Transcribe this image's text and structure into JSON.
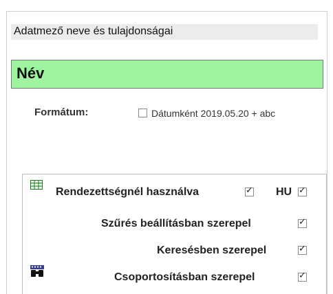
{
  "section_title": "Adatmező neve és tulajdonságai",
  "field_name": "Név",
  "format": {
    "label": "Formátum:",
    "option_label": "Dátumként 2019.05.20 + abc",
    "checked": false
  },
  "options": [
    {
      "icon": "table-grid-icon",
      "label": "Rendezettségnél használva",
      "checked": true
    },
    {
      "label": "HU",
      "checked": true
    },
    {
      "label": "Szűrés beállításban szerepel",
      "checked": true
    },
    {
      "label": "Keresésben szerepel",
      "checked": true
    },
    {
      "icon": "binoculars-icon",
      "label": "Csoportosításban szerepel",
      "checked": true
    }
  ],
  "colors": {
    "name_box_bg": "#9ff59f",
    "header_bg": "#ececec"
  }
}
